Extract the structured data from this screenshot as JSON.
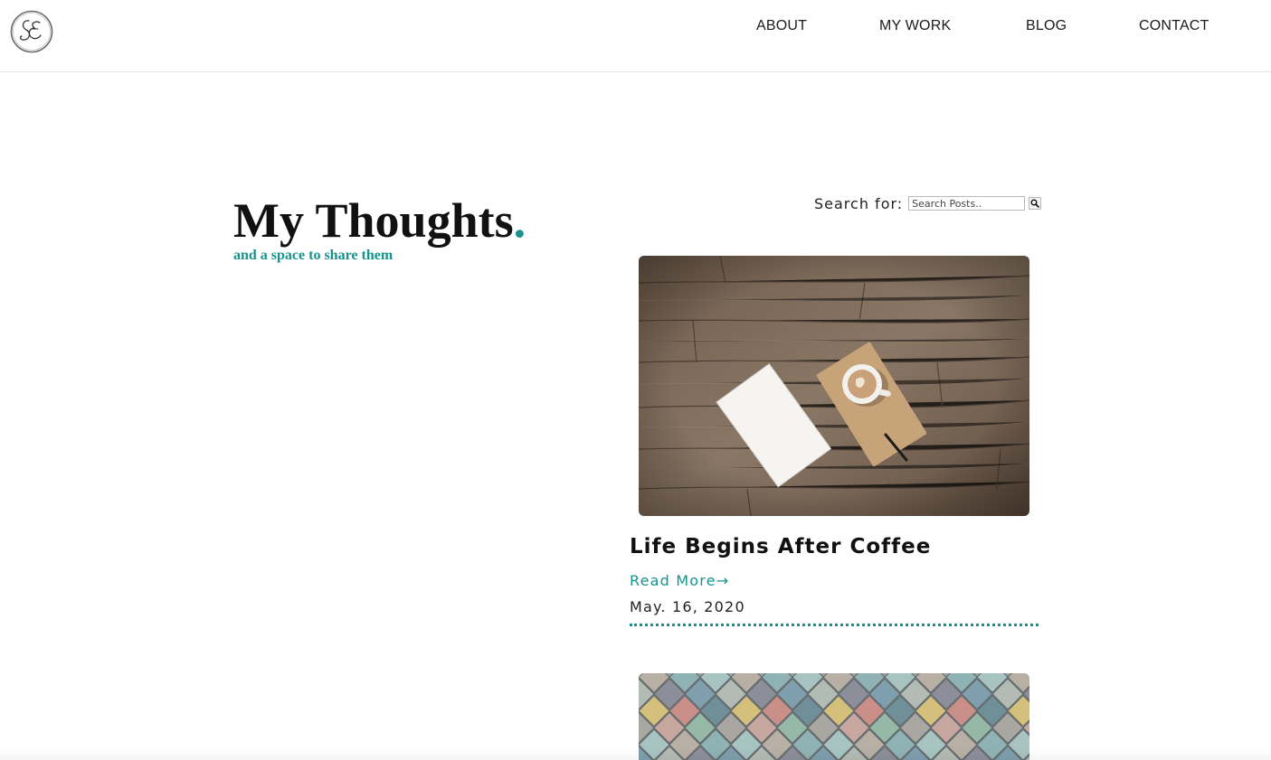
{
  "logo": {
    "monogram": "SE"
  },
  "nav": {
    "about": "ABOUT",
    "my_work": "MY WORK",
    "blog": "BLOG",
    "contact": "CONTACT"
  },
  "hero": {
    "title": "My Thoughts",
    "title_dot": ".",
    "subtitle": "and a space to share them"
  },
  "search": {
    "label": "Search for:",
    "placeholder": "Search Posts.."
  },
  "posts": [
    {
      "title": "Life Begins After Coffee",
      "read_more": "Read More",
      "read_more_arrow": "→",
      "date": "May. 16, 2020",
      "image": "coffee-notebook-on-wood-table-photo"
    },
    {
      "image": "colorful-scale-tiles-photo"
    }
  ],
  "colors": {
    "accent": "#17938d",
    "text": "#111111",
    "border": "#e2e2e2"
  },
  "icons": [
    "logo-monogram-icon",
    "search-icon",
    "arrow-right-icon"
  ]
}
